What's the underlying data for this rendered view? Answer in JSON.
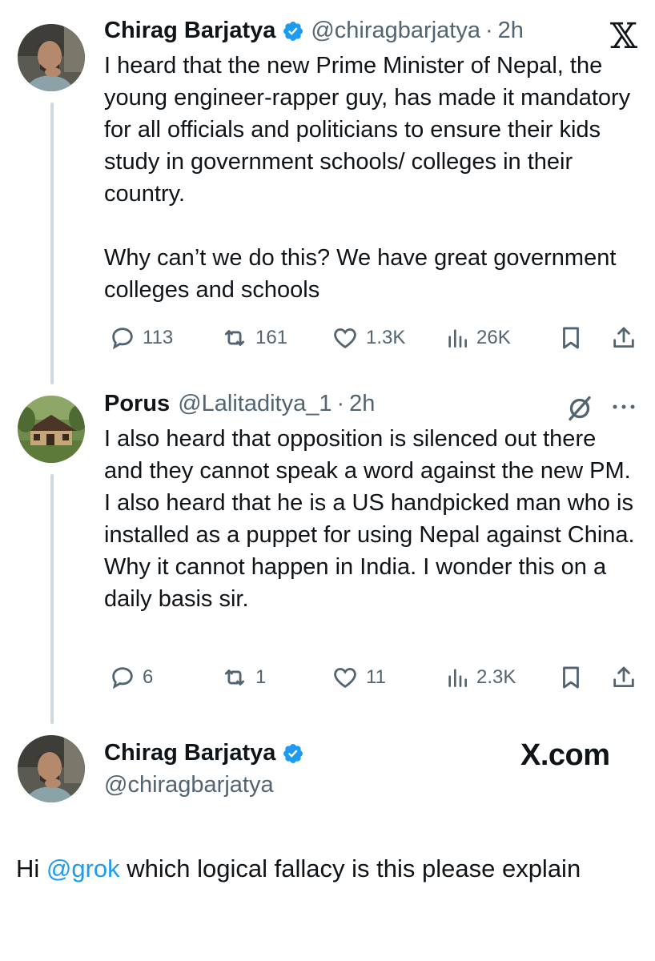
{
  "tweets": [
    {
      "author_name": "Chirag Barjatya",
      "handle": "@chiragbarjatya",
      "separator": "·",
      "time": "2h",
      "text": "I heard that the new Prime Minister of Nepal, the young engineer-rapper guy, has made it mandatory for all officials and politicians to ensure their kids study in government schools/ colleges in their country.\n\nWhy can’t we do this? We have great government colleges and schools",
      "replies": "113",
      "reposts": "161",
      "likes": "1.3K",
      "views": "26K"
    },
    {
      "author_name": "Porus",
      "handle": "@Lalitaditya_1",
      "separator": "·",
      "time": "2h",
      "text": "I also heard that opposition is silenced out there and they cannot speak a word against the new PM. I also heard that he is a US handpicked man who is installed as a puppet for using Nepal against China. Why it cannot happen in India. I wonder this on a daily basis sir.",
      "replies": "6",
      "reposts": "1",
      "likes": "11",
      "views": "2.3K"
    }
  ],
  "compose": {
    "author_name": "Chirag Barjatya",
    "handle": "@chiragbarjatya",
    "brand": "X.com",
    "reply_prefix": "Hi ",
    "mention": "@grok",
    "reply_rest": " which logical fallacy is this please explain"
  },
  "top_logo": "𝕏",
  "colors": {
    "accent": "#1d9bf0",
    "text": "#0f1419",
    "muted": "#536471",
    "thread_line": "#cfd9de"
  },
  "icons": [
    "x-logo-icon",
    "verified-badge-icon",
    "reply-icon",
    "repost-icon",
    "like-icon",
    "views-icon",
    "bookmark-icon",
    "share-icon",
    "grok-icon",
    "more-icon"
  ]
}
